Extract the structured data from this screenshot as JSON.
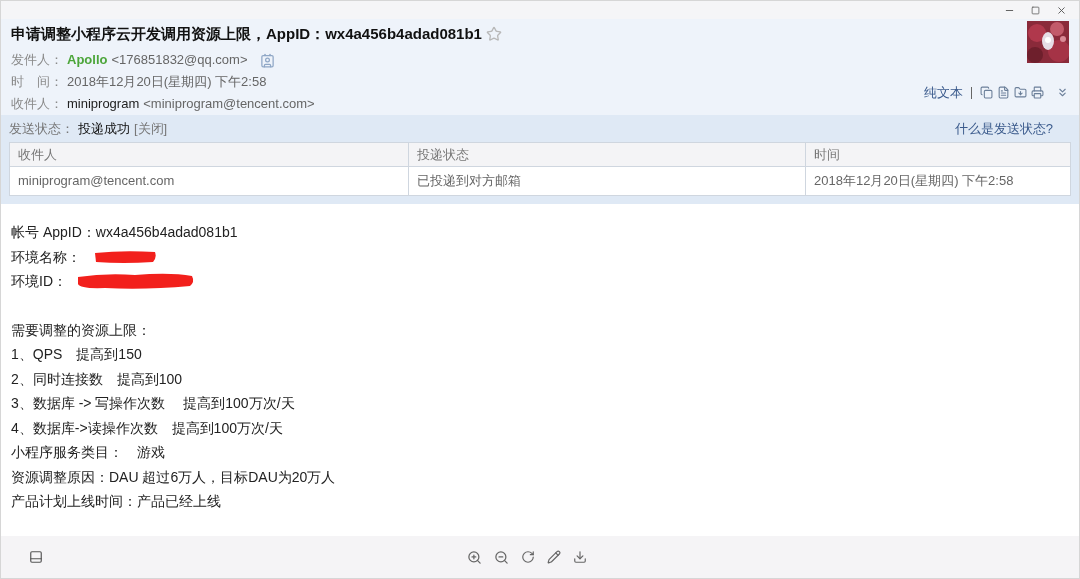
{
  "subject": "申请调整小程序云开发调用资源上限，AppID：wx4a456b4adad081b1",
  "starred": false,
  "fields": [
    {
      "label": "发件人：",
      "name": "Apollo",
      "address": "<176851832@qq.com>",
      "kind": "sender"
    },
    {
      "label": "时　间：",
      "value": "2018年12月20日(星期四) 下午2:58",
      "kind": "time"
    },
    {
      "label": "收件人：",
      "name": "miniprogram",
      "address": "<miniprogram@tencent.com>",
      "kind": "recipient"
    }
  ],
  "view_link": "纯文本",
  "status": {
    "label": "发送状态：",
    "value": "投递成功",
    "close": "[关闭]",
    "help": "什么是发送状态?"
  },
  "table": {
    "columns": [
      "收件人",
      "投递状态",
      "时间"
    ],
    "rows": [
      [
        "miniprogram@tencent.com",
        "已投递到对方邮箱",
        "2018年12月20日(星期四) 下午2:58"
      ]
    ]
  },
  "body": [
    [
      {
        "text": "帐号 AppID：wx4a456b4adad081b1",
        "redacted": false
      },
      {
        "text": "环境名称：",
        "redacted": true
      },
      {
        "text": "环境ID：",
        "redacted": true
      }
    ],
    [
      {
        "text": "需要调整的资源上限：",
        "redacted": false
      },
      {
        "text": "1、QPS　提高到150",
        "redacted": false
      },
      {
        "text": "2、同时连接数　提高到100",
        "redacted": false
      },
      {
        "text": "3、数据库 -> 写操作次数　 提高到100万次/天",
        "redacted": false
      },
      {
        "text": "4、数据库->读操作次数　提高到100万次/天",
        "redacted": false
      },
      {
        "text": "小程序服务类目：　游戏",
        "redacted": false
      },
      {
        "text": "资源调整原因：DAU 超过6万人，目标DAU为20万人",
        "redacted": false
      },
      {
        "text": "产品计划上线时间：产品已经上线",
        "redacted": false
      }
    ]
  ]
}
